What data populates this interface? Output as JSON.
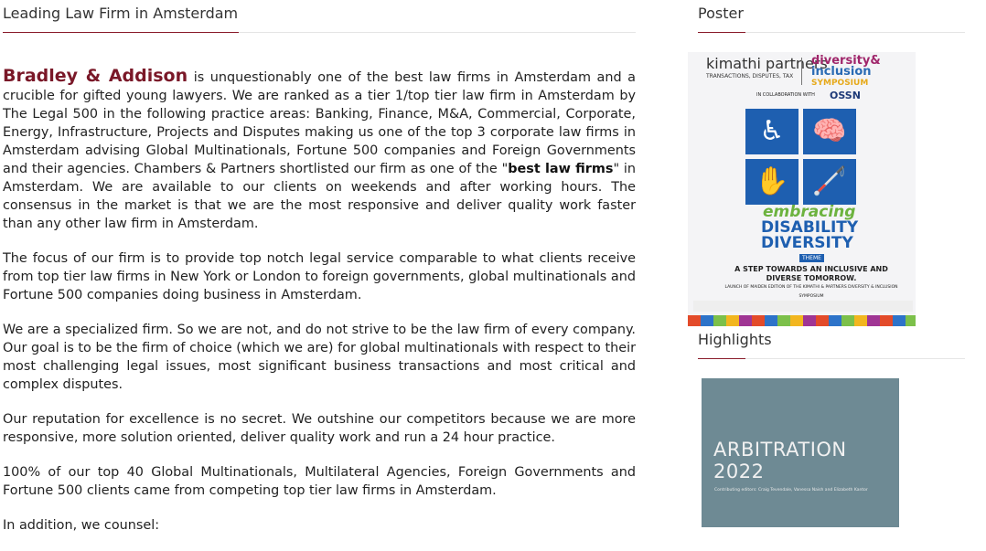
{
  "main": {
    "heading": "Leading Law Firm in Amsterdam",
    "brand": "Bradley & Addison",
    "p1": " is unquestionably one of the best law firms in Amsterdam and a crucible for gifted young lawyers. We are ranked as a tier 1/top tier law firm in Amsterdam by The Legal 500 in the following practice areas: Banking, Finance, M&A, Commercial, Corporate, Energy, Infrastructure, Projects and Disputes making us one of the top 3 corporate law firms in Amsterdam advising Global Multinationals, Fortune 500 companies and Foreign Governments and their agencies. Chambers & Partners shortlisted our firm as one of the \"",
    "p1_bold": "best law firms",
    "p1_end": "\" in Amsterdam. We are available to our clients on weekends and after working hours. The consensus in the market is that we are the most responsive and deliver quality work faster than any other law firm in Amsterdam.",
    "p2": "The focus of our firm is to provide top notch legal service comparable to what clients receive from top tier law firms in New York or London to foreign governments, global multinationals and Fortune 500 companies doing business in Amsterdam.",
    "p3": "We are a specialized firm. So we are not, and do not strive to be the law firm of every company. Our goal is to be the firm of choice (which we are) for global multinationals with respect to their most challenging legal issues, most significant business transactions and most critical and complex disputes.",
    "p4": "Our reputation for excellence is no secret. We outshine our competitors because we are more responsive, more solution oriented, deliver quality work and run a 24 hour practice.",
    "p5": "100% of our top 40 Global Multinationals, Multilateral Agencies, Foreign Governments and Fortune 500 clients came from competing top tier law firms in Amsterdam.",
    "p6": "In addition, we counsel:"
  },
  "sidebar": {
    "poster_heading": "Poster",
    "highlights_heading": "Highlights"
  },
  "poster": {
    "logo_left": "kimathi partners",
    "logo_left_sub": "TRANSACTIONS, DISPUTES, TAX",
    "logo_right_1": "diversity&",
    "logo_right_2": "inclusion",
    "logo_right_3": "SYMPOSIUM",
    "collab": "IN COLLABORATION WITH",
    "ossn": "OSSN",
    "embracing": "embracing",
    "disability": "DISABILITY",
    "diversity": "DIVERSITY",
    "theme": "THEME",
    "tagline": "A STEP TOWARDS AN INCLUSIVE AND DIVERSE TOMORROW.",
    "tagline_sub": "LAUNCH OF MAIDEN EDITION OF THE KIMATHI & PARTNERS DIVERSITY & INCLUSION SYMPOSIUM"
  },
  "highlight": {
    "title_1": "ARBITRATION",
    "title_2": "2022",
    "editors": "Contributing editors: Craig Tevendale, Vanessa Naish and Elizabeth Kantor"
  },
  "colors": {
    "accent": "#8a1c2b",
    "brand": "#7a1828",
    "poster_blue": "#1e5fb0"
  }
}
